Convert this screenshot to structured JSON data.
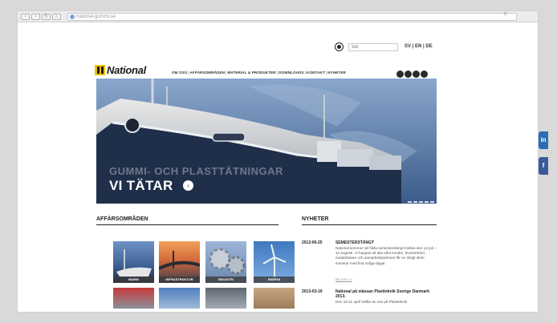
{
  "browser": {
    "address": "national-gummi.se",
    "reload_glyph": "c"
  },
  "utility": {
    "search_placeholder": "Sök",
    "languages": "SV | EN | DE",
    "globe_icon": "globe-icon"
  },
  "header": {
    "logo_text": "National",
    "nav": [
      "OM OSS",
      "AFFÄRSOMRÅDEN",
      "MATERIAL & PRODUKTER",
      "DOWNLOADS",
      "KONTAKT",
      "NYHETER"
    ],
    "social_icons": [
      "social-icon-1",
      "social-icon-2",
      "social-icon-3",
      "social-icon-4"
    ]
  },
  "hero": {
    "background_text": "GUMMI- OCH PLASTTÄTNINGAR",
    "title": "VI TÄTAR",
    "arrow_glyph": "›",
    "slides": 5
  },
  "areas": {
    "heading": "AFFÄRSOMRÅDEN",
    "tiles": [
      {
        "label": "MARIN"
      },
      {
        "label": "INFRASTRUKTUR"
      },
      {
        "label": "INDUSTRI"
      },
      {
        "label": "ENERGI"
      },
      {
        "label": ""
      },
      {
        "label": ""
      },
      {
        "label": ""
      },
      {
        "label": ""
      }
    ]
  },
  "news": {
    "heading": "NYHETER",
    "items": [
      {
        "date": "2013-06-25",
        "title": "SEMESTERSTÄNGT",
        "body": "National kommer att hålla semesterstängt mellan den 12 juli – 12 augusti. Vi hoppas att alla våra kunder, leverantörer, medarbetare och samarbetspartners får en riktigt skön sommar med fina soliga dagar.",
        "more": "läs mer >>"
      },
      {
        "date": "2013-03-19",
        "title": "National på mässan Plastteknik Sverige Danmark 2013.",
        "body": "Den 10-11 april träffar du oss på Plastteknik",
        "more": ""
      }
    ]
  },
  "side": {
    "linkedin": "in",
    "facebook": "f"
  },
  "colors": {
    "logo_yellow": "#f2c200",
    "hero_blue": "#5d7fae",
    "linkedin_blue": "#2a6db3",
    "facebook_blue": "#3b5a9a"
  }
}
